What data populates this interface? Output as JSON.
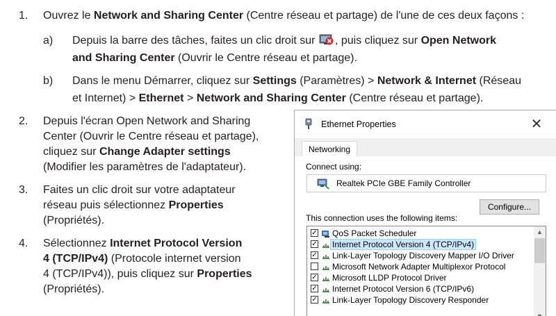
{
  "steps": [
    {
      "number": "1.",
      "segments": [
        {
          "text": "Ouvrez le ",
          "bold": false
        },
        {
          "text": "Network and Sharing Center",
          "bold": true
        },
        {
          "text": " (Centre réseau et partage) de l'une de ces deux façons :",
          "bold": false
        }
      ]
    },
    {
      "number": "2.",
      "lines": [
        "Depuis l'écran Open Network and Sharing",
        "Center (Ouvrir le Centre réseau et partage),",
        "cliquez sur",
        "Change Adapter settings",
        "(Modifier les paramètres de l'adaptateur)."
      ]
    },
    {
      "number": "3.",
      "lines": [
        "Faites un clic droit sur votre adaptateur",
        "réseau puis sélectionnez",
        "Properties",
        "(Propriétés)."
      ]
    },
    {
      "number": "4.",
      "lines": [
        "Sélectionnez",
        "Internet Protocol Version",
        "4 (TCP/IPv4)",
        " (Protocole internet version",
        "4 (TCP/IPv4)), puis cliquez sur",
        "Properties",
        "(Propriétés)."
      ]
    }
  ],
  "substeps": [
    {
      "letter": "a)",
      "t1": "Depuis la barre des tâches, faites un clic droit sur ",
      "t2": ", puis cliquez sur ",
      "b1": "Open Network",
      "b2": "and Sharing Center",
      "t3": " (Ouvrir le Centre réseau et partage)."
    },
    {
      "letter": "b)",
      "t1": "Dans le menu Démarrer, cliquez sur ",
      "b1": "Settings",
      "t2": " (Paramètres) > ",
      "b2": "Network & Internet",
      "t3": " (Réseau",
      "t4": "et Internet) > ",
      "b3": "Ethernet",
      "t5": " > ",
      "b4": "Network and Sharing Center",
      "t6": " (Centre réseau et partage)."
    }
  ],
  "dialog": {
    "title": "Ethernet Properties",
    "close_glyph": "✕",
    "tab": "Networking",
    "connect_using_label": "Connect using:",
    "adapter_name": "Realtek PCIe GBE Family Controller",
    "configure_button": "Configure...",
    "items_label": "This connection uses the following items:",
    "items": [
      {
        "checked": true,
        "label": "QoS Packet Scheduler",
        "icon": "qos-icon",
        "selected": false
      },
      {
        "checked": true,
        "label": "Internet Protocol Version 4 (TCP/IPv4)",
        "icon": "protocol-icon",
        "selected": true
      },
      {
        "checked": true,
        "label": "Link-Layer Topology Discovery Mapper I/O Driver",
        "icon": "protocol-icon",
        "selected": false
      },
      {
        "checked": false,
        "label": "Microsoft Network Adapter Multiplexor Protocol",
        "icon": "protocol-icon",
        "selected": false
      },
      {
        "checked": true,
        "label": "Microsoft LLDP Protocol Driver",
        "icon": "protocol-icon",
        "selected": false
      },
      {
        "checked": true,
        "label": "Internet Protocol Version 6 (TCP/IPv6)",
        "icon": "protocol-icon",
        "selected": false
      },
      {
        "checked": true,
        "label": "Link-Layer Topology Discovery Responder",
        "icon": "protocol-icon",
        "selected": false
      }
    ],
    "check_glyph": "✓",
    "scroll_up_glyph": "▲",
    "scroll_down_glyph": "▼"
  },
  "colors": {
    "text": "#231f20",
    "selection": "#cce8ff",
    "network_icon_red": "#d8262b"
  }
}
